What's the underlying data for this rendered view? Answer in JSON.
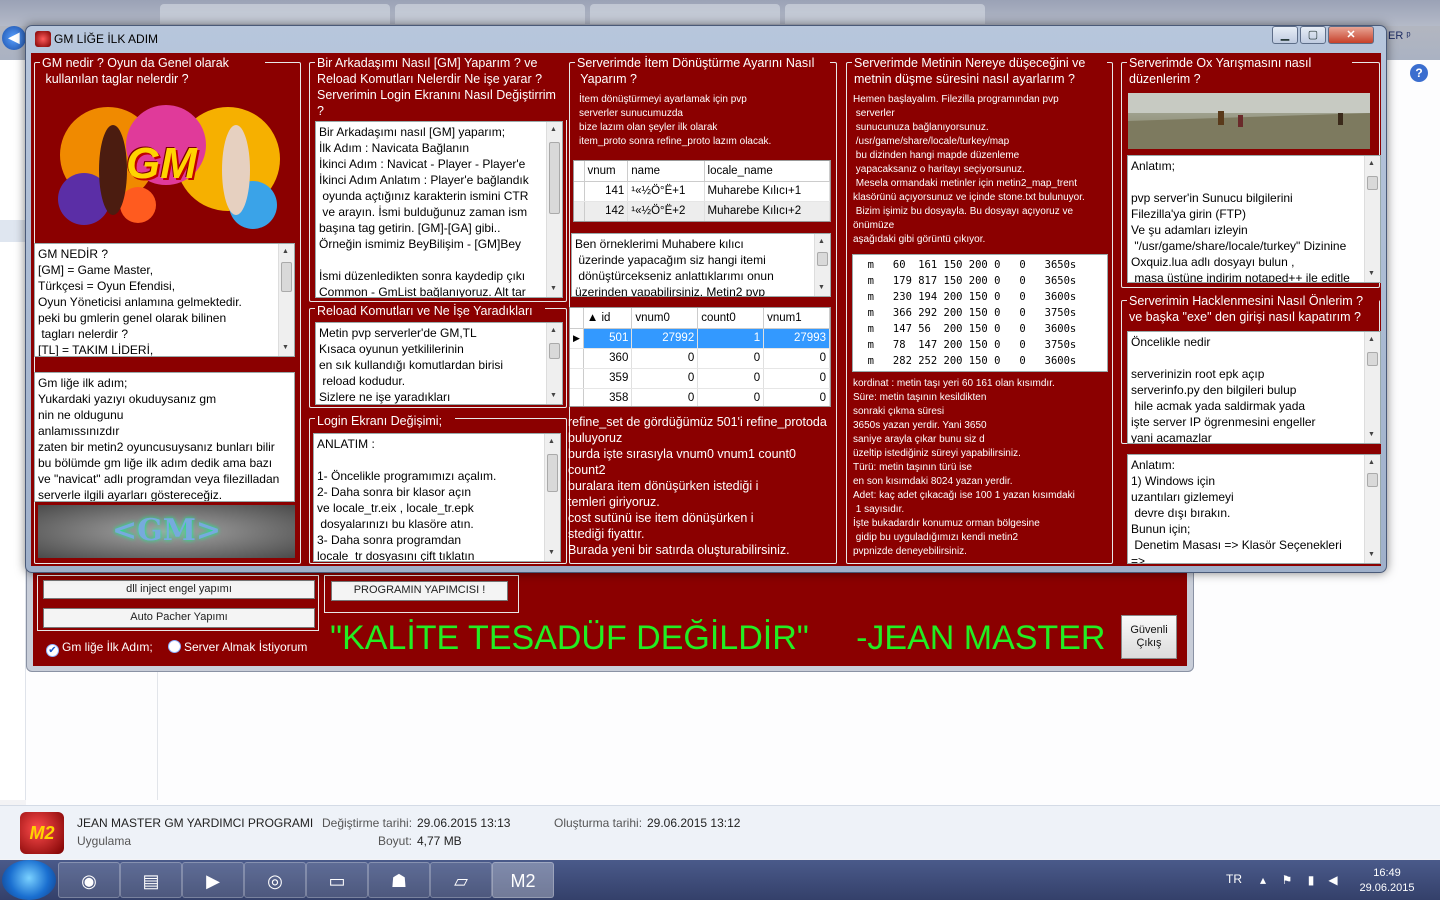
{
  "browser": {
    "right_text": "ER ᵖ",
    "help": "?"
  },
  "main_app": {
    "btn_dll": "dll inject engel yapımı",
    "btn_autopatcher": "Auto Pacher Yapımı",
    "btn_author": "PROGRAMIN YAPIMCISI !",
    "radio_gm": "Gm liğe İlk Adım;",
    "radio_server": "Server Almak İstiyorum",
    "slogan": "\"KALİTE TESADÜF DEĞİLDİR\"     -JEAN MASTER",
    "btn_exit": "Güvenli Çıkış"
  },
  "details": {
    "name": "JEAN MASTER GM YARDIMCI PROGRAMI",
    "type": "Uygulama",
    "modified_label": "Değiştirme tarihi:",
    "modified": "29.06.2015 13:13",
    "size_label": "Boyut:",
    "size": "4,77 MB",
    "created_label": "Oluşturma tarihi:",
    "created": "29.06.2015 13:12"
  },
  "taskbar": {
    "lang": "TR",
    "time": "16:49",
    "date": "29.06.2015"
  },
  "window": {
    "title": "GM LİĞE İLK ADIM"
  },
  "col1": {
    "title": "GM nedir ? Oyun da Genel olarak\n kullanılan taglar nelerdir ?",
    "gm_text": "GM NEDİR ?\n[GM] = Game Master,\nTürkçesi = Oyun Efendisi,\nOyun Yöneticisi anlamına gelmektedir.\npeki bu gmlerin genel olarak bilinen\n tagları nelerdir ?\n[TL] = TAKIM LİDERİ,",
    "intro_text": "Gm liğe ilk adım;\nYukardaki yazıyı okuduysanız gm\nnin ne oldugunu\nanlamıssınızdır\nzaten bir metin2 oyuncusuysanız bunları bilir\nbu bölümde gm liğe ilk adım dedik ama bazı\nve \"navicat\" adlı programdan veya filezilladan\nserverle ilgili ayarları göstereceğiz.",
    "logo_text": "GM",
    "banner_text": "<GM>"
  },
  "col2": {
    "title": "Bir Arkadaşımı Nasıl [GM] Yaparım ? ve\nReload Komutları Nelerdir Ne işe yarar ?\nServerimin Login Ekranını Nasıl Değiştirrim\n?",
    "gm_make_text": "Bir Arkadaşımı nasıl [GM] yaparım;\nİlk Adım : Navicata Bağlanın\nİkinci Adım : Navicat - Player - Player'e\nİkinci Adım Anlatım : Player'e bağlandık\n oyunda açtığınız karakterin ismini CTR\n ve arayın. İsmi bulduğunuz zaman ism\nbaşına tag getirin. [GM]-[GA] gibi..\nÖrneğin ismimiz BeyBilişim - [GM]Bey\n\nİsmi düzenledikten sonra kaydedip çıkı\nCommon - GmList bağlanıyoruz. Alt tar",
    "reload_title": "Reload Komutları ve Ne İşe Yaradıkları",
    "reload_text": "Metin pvp serverler'de GM,TL\nKısaca oyunun yetkililerinin\nen sık kullandığı komutlardan birisi\n reload kodudur.\nSizlere ne işe yaradıkları",
    "login_title": "Login Ekranı Değişimi;",
    "login_text": "ANLATIM :\n\n1- Öncelikle programımızı açalım.\n2- Daha sonra bir klasor açın\nve locale_tr.eix , locale_tr.epk\n dosyalarınızı bu klasöre atın.\n3- Daha sonra programdan\nlocale_tr dosyasını çift tıklatın"
  },
  "col3": {
    "title": "Serverimde İtem Dönüştürme Ayarını Nasıl\n Yaparım ?",
    "intro": "İtem dönüştürmeyi ayarlamak için pvp\nserverler sunucumuzda\nbize lazım olan şeyler ilk olarak\nitem_proto sonra refine_proto lazım olacak.",
    "grid1": {
      "headers": [
        "vnum",
        "name",
        "locale_name"
      ],
      "rows": [
        [
          "141",
          "¹«½Ö°Ë+1",
          "Muharebe Kılıcı+1"
        ],
        [
          "142",
          "¹«½Ö°Ë+2",
          "Muharebe Kılıcı+2"
        ]
      ]
    },
    "mid_text": "Ben örneklerimi Muhabere kılıcı\n üzerinde yapacağım siz hangi itemi\n dönüştürcekseniz anlattıklarımı onun\nüzerinden yapabilirsiniz. Metin2 pvp",
    "grid2": {
      "headers": [
        "id",
        "vnum0",
        "count0",
        "vnum1"
      ],
      "rows": [
        [
          "501",
          "27992",
          "1",
          "27993"
        ],
        [
          "360",
          "0",
          "0",
          "0"
        ],
        [
          "359",
          "0",
          "0",
          "0"
        ],
        [
          "358",
          "0",
          "0",
          "0"
        ]
      ]
    },
    "bottom_text": "refine_set de gördüğümüz 501'i refine_protoda\nbuluyoruz\nburda işte sırasıyla vnum0 vnum1 count0\ncount2\nburalara item dönüşürken istediği i\ntemleri giriyoruz.\ncost sutünü ise item dönüşürken i\nstediği fiyattır.\nBurada yeni bir satırda oluşturabilirsiniz."
  },
  "col4": {
    "title": "Serverimde Metinin Nereye düşeceğini ve\nmetnin düşme süresini nasıl ayarlarım ?",
    "intro": "Hemen başlayalım. Filezilla programından pvp\n serverler\n sunucunuza bağlanıyorsunuz.\n /usr/game/share/locale/turkey/map\n bu dizinden hangi mapde düzenleme\n yapacaksanız o haritayı seçiyorsunuz.\n Mesela ormandaki metinler için metin2_map_trent\nklasörünü açıyorsunuz ve içinde stone.txt bulunuyor.\n Bizim işimiz bu dosyayla. Bu dosyayı açıyoruz ve\nönümüze\naşağıdaki gibi görüntü çıkıyor.",
    "code": "  m   60  161 150 200 0   0   3650s\n  m   179 817 150 200 0   0   3650s\n  m   230 194 200 150 0   0   3600s\n  m   366 292 200 150 0   0   3750s\n  m   147 56  200 150 0   0   3600s\n  m   78  147 200 150 0   0   3750s\n  m   282 252 200 150 0   0   3600s",
    "explain": "kordinat : metin taşı yeri 60 161 olan kısımdır.\nSüre: metin taşının kesildikten\nsonraki çıkma süresi\n3650s yazan yerdir. Yani 3650\nsaniye arayla çıkar bunu siz d\nüzeltip istediğiniz süreyi yapabilirsiniz.\nTürü: metin taşının türü ise\nen son kısımdaki 8024 yazan yerdir.\nAdet: kaç adet çıkacağı ise 100 1 yazan kısımdaki\n 1 sayısıdır.\nİşte bukadardır konumuz orman bölgesine\n gidip bu uyguladığımızı kendi metin2\npvpnizde deneyebilirsiniz."
  },
  "col5": {
    "title": "Serverimde Ox Yarışmasını nasıl\ndüzenlerim ?",
    "ox_text": "Anlatım;\n\npvp server'in Sunucu bilgilerini\nFilezilla'ya girin (FTP)\nVe şu adamları izleyin\n \"/usr/game/share/locale/turkey\" Dizinine\nOxquiz.lua adlı dosyayı bulun ,\n masa üstüne indirim notaped++ ile editle",
    "hack_title": "Serverimin Hacklenmesini Nasıl Önlerim ?\nve başka \"exe\" den girişi nasıl kapatırım ?",
    "hack_text": "Öncelikle nedir\n\nserverinizin root epk açıp\nserverinfo.py den bilgileri bulup\n hile acmak yada saldirmak yada\nişte server IP ögrenmesini engeller\nyani acamazlar",
    "win_text": "Anlatım:\n1) Windows için\nuzantıları gizlemeyi\n devre dışı bırakın.\nBunun için;\n Denetim Masası => Klasör Seçenekleri\n=>"
  }
}
